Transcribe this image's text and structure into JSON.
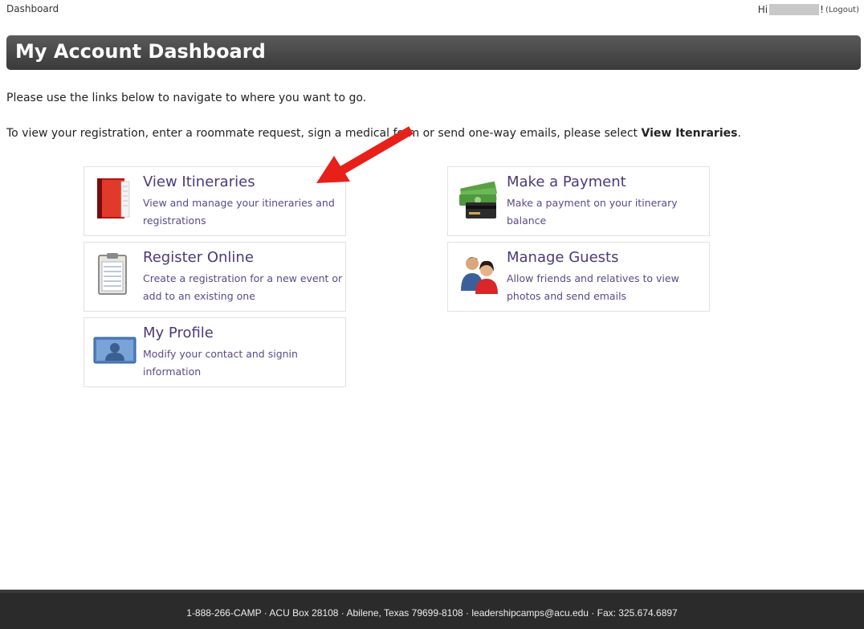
{
  "header": {
    "breadcrumb": "Dashboard",
    "greeting": "Hi",
    "greeting_suffix": "!",
    "logout_label": "(Logout)"
  },
  "title": "My Account Dashboard",
  "intro_text": "Please use the links below to navigate to where you want to go.",
  "instruction": {
    "before": "To view your registration, enter a roommate request, sign a medical form or send one-way emails, please select ",
    "bold": "View Itenraries",
    "after": "."
  },
  "tiles": {
    "view_itineraries": {
      "title": "View Itineraries",
      "description": "View and manage your itineraries and registrations",
      "icon": "red-folder-icon"
    },
    "make_payment": {
      "title": "Make a Payment",
      "description": "Make a payment on your itinerary balance",
      "icon": "money-card-icon"
    },
    "register_online": {
      "title": "Register Online",
      "description": "Create a registration for a new event or add to an existing one",
      "icon": "clipboard-icon"
    },
    "manage_guests": {
      "title": "Manage Guests",
      "description": "Allow friends and relatives to view photos and send emails",
      "icon": "people-icon"
    },
    "my_profile": {
      "title": "My Profile",
      "description": "Modify your contact and signin information",
      "icon": "profile-card-icon"
    }
  },
  "footer": {
    "text": "1-888-266-CAMP · ACU Box 28108 · Abilene, Texas 79699-8108 · leadershipcamps@acu.edu · Fax: 325.674.6897"
  },
  "colors": {
    "title_bar": "#444444",
    "tile_text": "#4b3a78",
    "footer_bg": "#2b2b2b",
    "annotation_arrow": "#e8201a"
  }
}
